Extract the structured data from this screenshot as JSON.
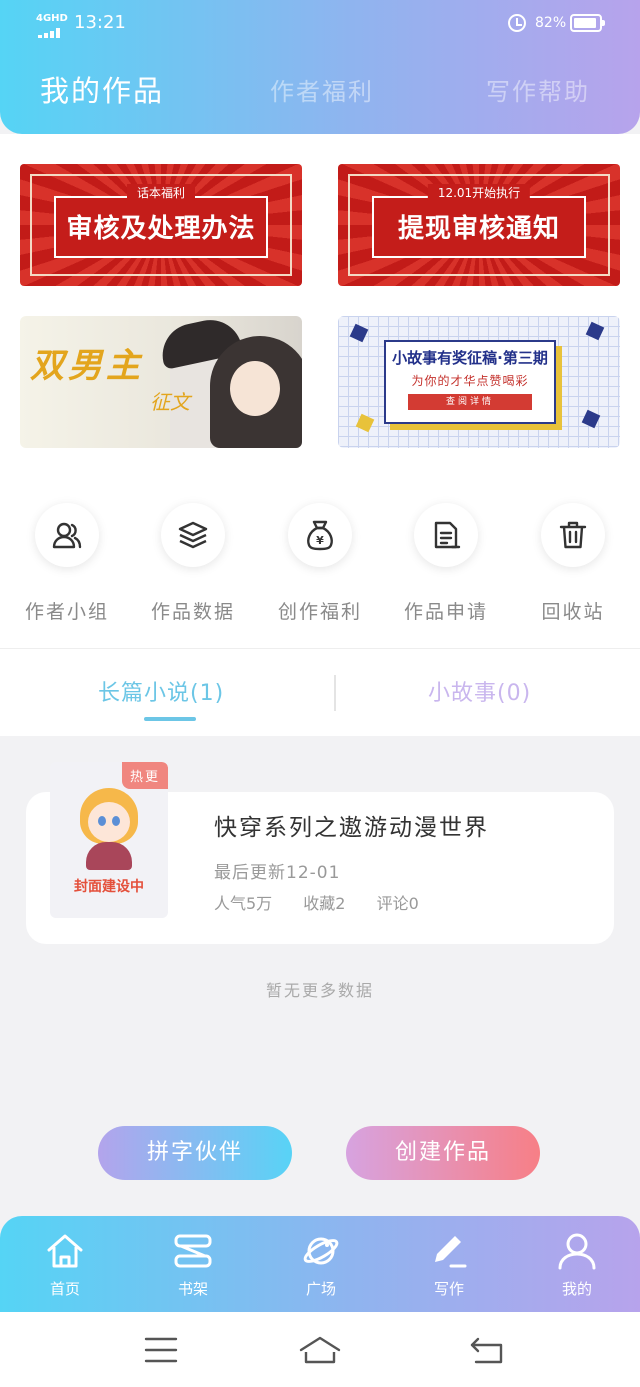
{
  "status_bar": {
    "network": "4GHD",
    "time": "13:21",
    "battery": "82%"
  },
  "top_tabs": [
    {
      "label": "我的作品",
      "active": true
    },
    {
      "label": "作者福利",
      "active": false
    },
    {
      "label": "写作帮助",
      "active": false
    }
  ],
  "banners": {
    "review": {
      "small": "话本福利",
      "big": "审核及处理办法"
    },
    "withdraw": {
      "small": "12.01开始执行",
      "big": "提现审核通知"
    },
    "danmei": {
      "title": "双男主",
      "sub": "征文"
    },
    "story_contest": {
      "line1": "小故事有奖征稿·第三期",
      "line2": "为你的才华点赞喝彩",
      "button": "查阅详情"
    }
  },
  "quick_actions": [
    {
      "label": "作者小组",
      "icon": "users-icon"
    },
    {
      "label": "作品数据",
      "icon": "layers-icon"
    },
    {
      "label": "创作福利",
      "icon": "money-bag-icon"
    },
    {
      "label": "作品申请",
      "icon": "document-icon"
    },
    {
      "label": "回收站",
      "icon": "trash-icon"
    }
  ],
  "works_tabs": [
    {
      "label": "长篇小说(1)",
      "active": true
    },
    {
      "label": "小故事(0)",
      "active": false
    }
  ],
  "novel": {
    "tag": "热更",
    "cover_text": "封面建设中",
    "title": "快穿系列之遨游动漫世界",
    "last_update": "最后更新12-01",
    "popularity": "人气5万",
    "favorites": "收藏2",
    "comments": "评论0"
  },
  "no_more": "暂无更多数据",
  "buttons": {
    "partner": "拼字伙伴",
    "create": "创建作品"
  },
  "bottom_nav": [
    {
      "label": "首页",
      "icon": "home-icon"
    },
    {
      "label": "书架",
      "icon": "bookshelf-icon"
    },
    {
      "label": "广场",
      "icon": "planet-icon"
    },
    {
      "label": "写作",
      "icon": "pen-icon"
    },
    {
      "label": "我的",
      "icon": "user-icon"
    }
  ],
  "colors": {
    "header_start": "#55d4f5",
    "header_end": "#b7a3ec",
    "active_tab": "#6cc6e6",
    "accent_pink": "#f77f86"
  }
}
